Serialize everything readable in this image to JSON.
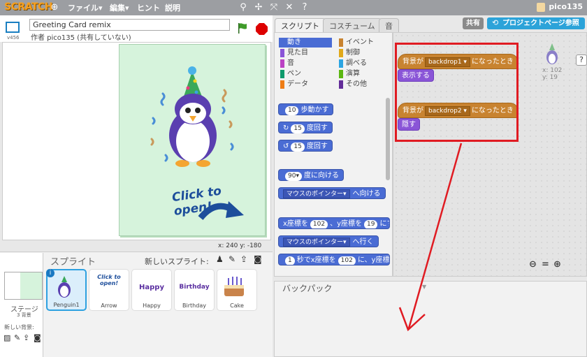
{
  "topbar": {
    "logo": "SCRATCH",
    "menus": [
      "ファイル▾",
      "編集▾",
      "ヒント",
      "説明"
    ],
    "user": "pico135"
  },
  "stage": {
    "project_title": "Greeting Card remix",
    "author": "作者 pico135 (共有していない)",
    "version": "v456",
    "card_text": "Click to open!",
    "coords": "x: 240  y: -180"
  },
  "sprites": {
    "header": "スプライト",
    "new_sprite": "新しいスプライト:",
    "stage_label": "ステージ",
    "stage_sub": "3 背景",
    "new_backdrop": "新しい背景:",
    "items": [
      {
        "name": "Penguin1",
        "preview": "",
        "selected": true
      },
      {
        "name": "Arrow",
        "preview": "Click to open!",
        "selected": false
      },
      {
        "name": "Happy",
        "preview": "Happy",
        "selected": false
      },
      {
        "name": "Birthday",
        "preview": "Birthday",
        "selected": false
      },
      {
        "name": "Cake",
        "preview": "",
        "selected": false
      }
    ]
  },
  "tabs": [
    "スクリプト",
    "コスチューム",
    "音"
  ],
  "share": "共有",
  "project_page": "プロジェクトページ参照",
  "categories": [
    {
      "label": "動き",
      "color": "#4a6cd4",
      "active": true
    },
    {
      "label": "イベント",
      "color": "#c88330",
      "active": false
    },
    {
      "label": "見た目",
      "color": "#8a55d7",
      "active": false
    },
    {
      "label": "制御",
      "color": "#e1a91a",
      "active": false
    },
    {
      "label": "音",
      "color": "#bb42c3",
      "active": false
    },
    {
      "label": "調べる",
      "color": "#2ca5e2",
      "active": false
    },
    {
      "label": "ペン",
      "color": "#0e9a6c",
      "active": false
    },
    {
      "label": "演算",
      "color": "#5cb712",
      "active": false
    },
    {
      "label": "データ",
      "color": "#ee7d16",
      "active": false
    },
    {
      "label": "その他",
      "color": "#632d99",
      "active": false
    }
  ],
  "palette_blocks": {
    "move": {
      "num": "10",
      "text": "歩動かす"
    },
    "turn_right": {
      "num": "15",
      "text": "度回す"
    },
    "turn_left": {
      "num": "15",
      "text": "度回す"
    },
    "point_dir": {
      "num": "90▾",
      "text": "度に向ける"
    },
    "point_towards": {
      "dd": "マウスのポインター▾",
      "text": "へ向ける"
    },
    "goto_xy": {
      "t1": "x座標を",
      "x": "102",
      "t2": "、y座標を",
      "y": "19",
      "t3": "にする"
    },
    "goto": {
      "dd": "マウスのポインター▾",
      "text": "へ行く"
    },
    "glide": {
      "num": "1",
      "t1": "秒でx座標を",
      "x": "102",
      "t2": "に、y座標を"
    }
  },
  "scripts": [
    {
      "hat_pre": "背景が",
      "backdrop": "backdrop1 ▾",
      "hat_post": "になったとき",
      "action": "表示する"
    },
    {
      "hat_pre": "背景が",
      "backdrop": "backdrop2 ▾",
      "hat_post": "になったとき",
      "action": "隠す"
    }
  ],
  "sprite_info": {
    "x": "x: 102",
    "y": "y: 19"
  },
  "zoom": [
    "⊖",
    "=",
    "⊕"
  ],
  "backpack": "バックパック",
  "help": "?",
  "colors": {
    "highlight": "#e01b22",
    "motion": "#4a6cd4",
    "events": "#c88330",
    "looks": "#8a55d7"
  }
}
